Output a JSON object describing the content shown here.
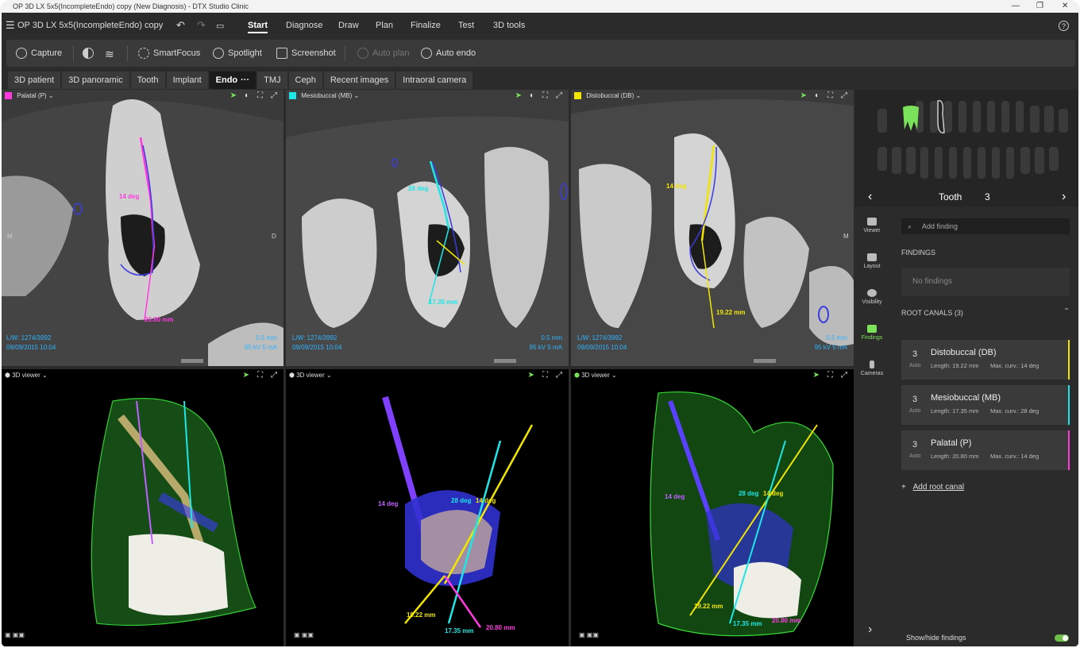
{
  "window": {
    "title": "OP 3D LX 5x5(IncompleteEndo) copy (New Diagnosis) - DTX Studio Clinic"
  },
  "menubar": {
    "doc_title": "OP 3D LX 5x5(IncompleteEndo) copy",
    "items": [
      "Start",
      "Diagnose",
      "Draw",
      "Plan",
      "Finalize",
      "Test",
      "3D tools"
    ],
    "help": "?"
  },
  "toolbar": {
    "capture": "Capture",
    "smartfocus": "SmartFocus",
    "spotlight": "Spotlight",
    "screenshot": "Screenshot",
    "autoplan": "Auto plan",
    "autoendo": "Auto endo"
  },
  "tabs": [
    "3D patient",
    "3D panoramic",
    "Tooth",
    "Implant",
    "Endo",
    "···",
    "TMJ",
    "Ceph",
    "Recent images",
    "Intraoral camera"
  ],
  "slices": [
    {
      "title": "Palatal (P)",
      "color": "#ff3be0",
      "lw": "L/W: 1274/3992",
      "date": "09/09/2015 10:04",
      "res": "0.5 mm",
      "kv": "95 kV  5 mA",
      "deg": "14 deg",
      "len": "20.80 mm",
      "left_side": "M",
      "right_side": "D"
    },
    {
      "title": "Mesiobuccal (MB)",
      "color": "#1ee6e6",
      "lw": "L/W: 1274/3992",
      "date": "09/09/2015 10:04",
      "res": "0.5 mm",
      "kv": "95 kV  5 mA",
      "deg": "28 deg",
      "len": "17.35 mm"
    },
    {
      "title": "Distobuccal (DB)",
      "color": "#f2e600",
      "lw": "L/W: 1274/3992",
      "date": "09/09/2015 10:04",
      "res": "0.5 mm",
      "kv": "95 kV  5 mA",
      "deg": "14 deg",
      "len": "19.22 mm",
      "right_side": "M"
    }
  ],
  "viewers3d": [
    {
      "title": "3D viewer"
    },
    {
      "title": "3D viewer",
      "labels": {
        "p_deg": "14 deg",
        "mb_deg": "28 deg",
        "db_deg": "14 deg",
        "db_len": "19.22 mm",
        "mb_len": "17.35 mm",
        "p_len": "20.80 mm"
      }
    },
    {
      "title": "3D viewer",
      "labels": {
        "p_deg": "14 deg",
        "mb_deg": "28 deg",
        "db_deg": "14 deg",
        "db_len": "19.22 mm",
        "mb_len": "17.35 mm",
        "p_len": "20.80 mm"
      }
    }
  ],
  "tooth_nav": {
    "label": "Tooth",
    "number": "3"
  },
  "sidebar": [
    {
      "label": "Viewer"
    },
    {
      "label": "Layout"
    },
    {
      "label": "Visibility"
    },
    {
      "label": "Findings"
    },
    {
      "label": "Cameras"
    }
  ],
  "findings": {
    "search_placeholder": "Add finding",
    "title": "FINDINGS",
    "empty": "No findings",
    "root_canals_title": "ROOT CANALS (3)",
    "canals": [
      {
        "num": "3",
        "auto": "Auto",
        "name": "Distobuccal (DB)",
        "length": "Length: 19.22 mm",
        "curv": "Max. curv.: 14 deg",
        "color": "#f2e600"
      },
      {
        "num": "3",
        "auto": "Auto",
        "name": "Mesiobuccal (MB)",
        "length": "Length: 17.35 mm",
        "curv": "Max. curv.: 28 deg",
        "color": "#1ee6e6"
      },
      {
        "num": "3",
        "auto": "Auto",
        "name": "Palatal (P)",
        "length": "Length: 20.80 mm",
        "curv": "Max. curv.: 14 deg",
        "color": "#ff3be0"
      }
    ],
    "add_root_canal": "Add root canal",
    "show_hide": "Show/hide findings"
  }
}
